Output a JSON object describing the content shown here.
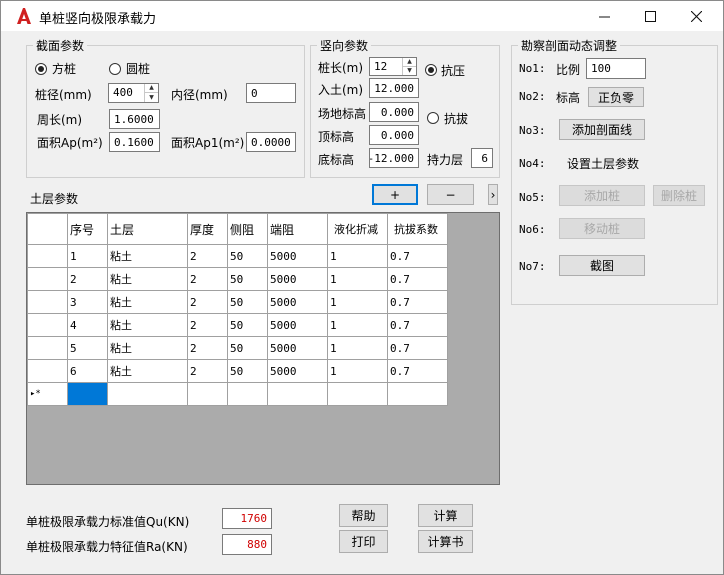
{
  "window": {
    "title": "单桩竖向极限承载力"
  },
  "section": {
    "title": "截面参数",
    "shape_square": "方桩",
    "shape_round": "圆桩",
    "diameter_label": "桩径(mm)",
    "diameter_value": "400",
    "inner_label": "内径(mm)",
    "inner_value": "0",
    "perimeter_label": "周长(m)",
    "perimeter_value": "1.6000",
    "area_label": "面积Ap(m²)",
    "area_value": "0.1600",
    "area1_label": "面积Ap1(m²)",
    "area1_value": "0.0000"
  },
  "vertical": {
    "title": "竖向参数",
    "length_label": "桩长(m)",
    "length_value": "12",
    "embed_label": "入土(m)",
    "embed_value": "12.000",
    "ground_label": "场地标高",
    "ground_value": "0.000",
    "top_label": "顶标高",
    "top_value": "0.000",
    "bottom_label": "底标高",
    "bottom_value": "-12.000",
    "compress": "抗压",
    "pullout": "抗拔",
    "bearing_label": "持力层",
    "bearing_value": "6"
  },
  "soil": {
    "title": "土层参数",
    "add_label": "+",
    "remove_label": "−",
    "more_label": "›",
    "columns": [
      "序号",
      "土层",
      "厚度",
      "侧阻",
      "端阻",
      "液化折减",
      "抗拔系数"
    ],
    "rows": [
      [
        "1",
        "粘土",
        "2",
        "50",
        "5000",
        "1",
        "0.7"
      ],
      [
        "2",
        "粘土",
        "2",
        "50",
        "5000",
        "1",
        "0.7"
      ],
      [
        "3",
        "粘土",
        "2",
        "50",
        "5000",
        "1",
        "0.7"
      ],
      [
        "4",
        "粘土",
        "2",
        "50",
        "5000",
        "1",
        "0.7"
      ],
      [
        "5",
        "粘土",
        "2",
        "50",
        "5000",
        "1",
        "0.7"
      ],
      [
        "6",
        "粘土",
        "2",
        "50",
        "5000",
        "1",
        "0.7"
      ]
    ],
    "new_row_marker": "▸*"
  },
  "profile": {
    "title": "勘察剖面动态调整",
    "no1": "No1:",
    "ratio_label": "比例",
    "ratio_value": "100",
    "no2": "No2:",
    "elev_label": "标高",
    "elev_button": "正负零",
    "no3": "No3:",
    "add_section_line": "添加剖面线",
    "no4": "No4:",
    "set_soil_params": "设置土层参数",
    "no5": "No5:",
    "add_pile": "添加桩",
    "delete_pile": "删除桩",
    "no6": "No6:",
    "move_pile": "移动桩",
    "no7": "No7:",
    "screenshot": "截图"
  },
  "results": {
    "qu_label": "单桩极限承载力标准值Qu(KN)",
    "qu_value": "1760",
    "ra_label": "单桩极限承载力特征值Ra(KN)",
    "ra_value": "880"
  },
  "actions": {
    "help": "帮助",
    "print": "打印",
    "calc": "计算",
    "report": "计算书"
  },
  "colors": {
    "accent": "#0078d7",
    "result_text": "#d00000",
    "app_icon": "#d02020"
  }
}
